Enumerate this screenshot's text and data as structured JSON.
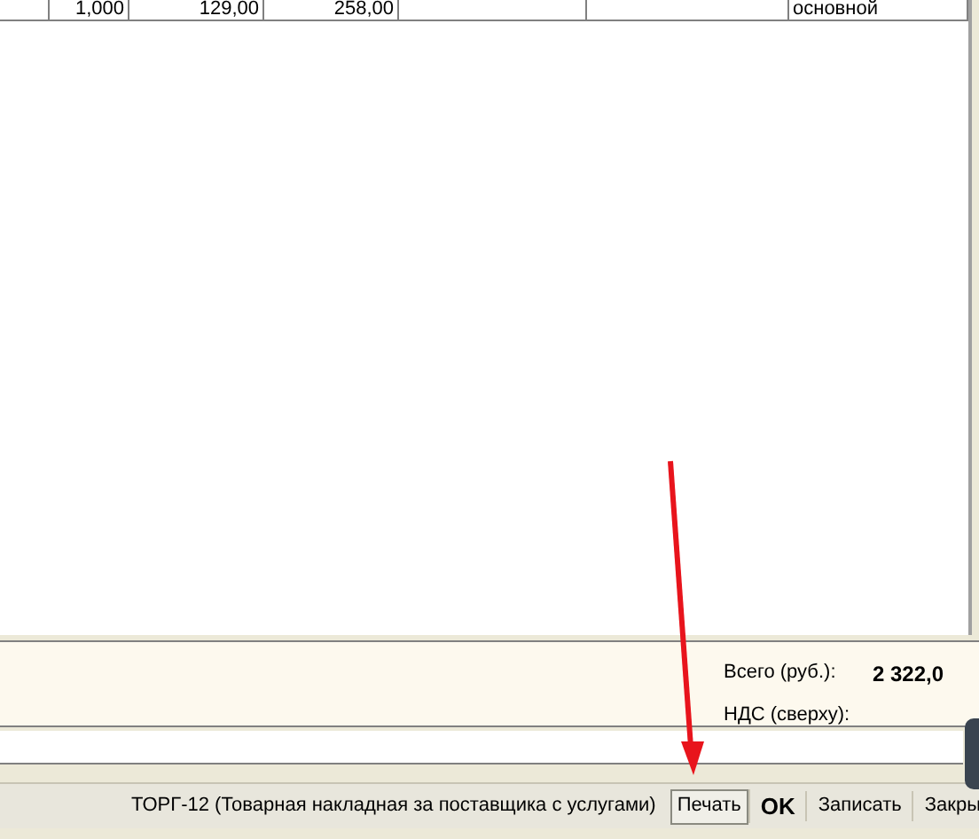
{
  "table": {
    "rows": [
      {
        "cells": [
          "",
          "1,000",
          "129,00",
          "258,00",
          "",
          "",
          "основной"
        ]
      }
    ]
  },
  "totals": {
    "total_label": "Всего (руб.):",
    "total_value": "2 322,0",
    "vat_label": "НДС (сверху):"
  },
  "bottom_bar": {
    "print_form": "ТОРГ-12 (Товарная накладная за поставщика с услугами)",
    "buttons": [
      {
        "label": "Печать",
        "kind": "framed"
      },
      {
        "label": "OK",
        "kind": "bold"
      },
      {
        "label": "Записать",
        "kind": "plain"
      },
      {
        "label": "Закры",
        "kind": "plain"
      }
    ]
  }
}
